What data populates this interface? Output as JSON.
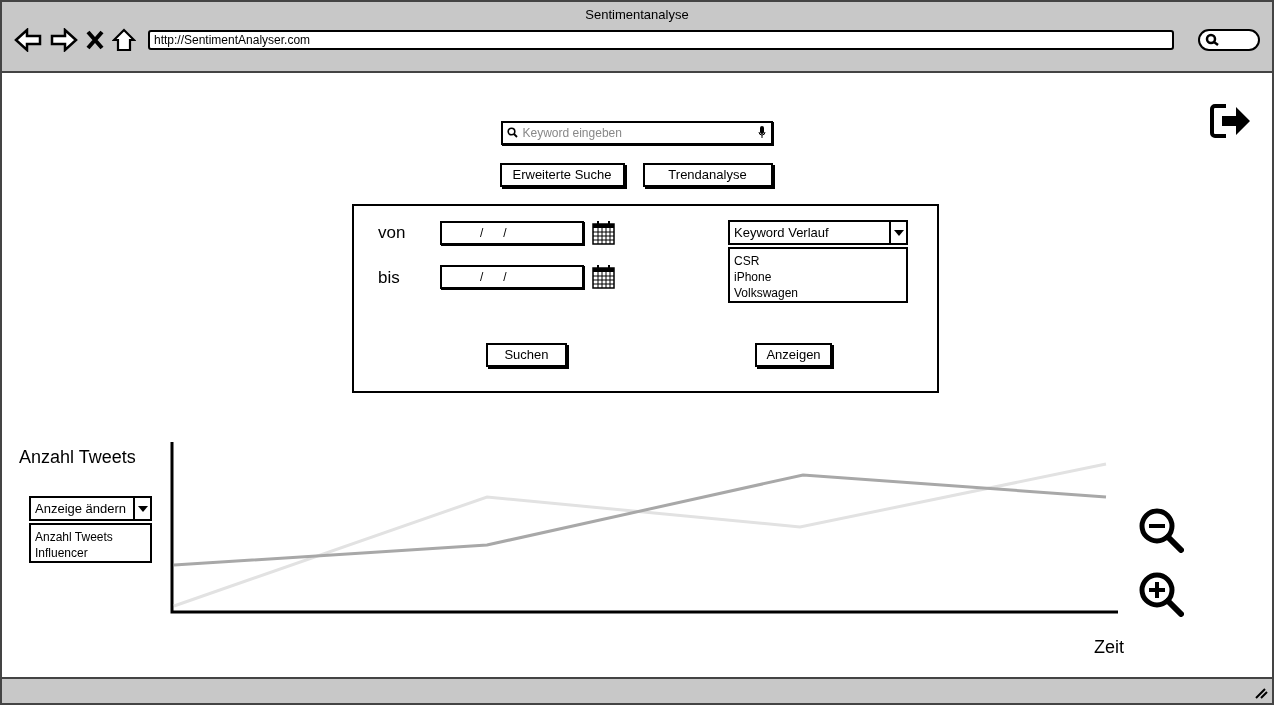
{
  "window": {
    "title": "Sentimentanalyse",
    "url": "http://SentimentAnalyser.com"
  },
  "search": {
    "placeholder": "Keyword eingeben"
  },
  "buttons": [
    "Erweiterte Suche",
    "Trendanalyse"
  ],
  "filter_panel": {
    "date_fields": [
      {
        "label": "von",
        "value": "/      /"
      },
      {
        "label": "bis",
        "value": "/      /"
      }
    ],
    "keyword_select": {
      "value": "Keyword Verlauf",
      "options": [
        "CSR",
        "iPhone",
        "Volkswagen"
      ]
    },
    "actions": [
      "Suchen",
      "Anzeigen"
    ]
  },
  "chart": {
    "ylabel": "Anzahl Tweets",
    "xlabel": "Zeit",
    "view_select": {
      "value": "Anzeige ändern",
      "options": [
        "Anzahl Tweets",
        "Influencer"
      ]
    }
  }
}
